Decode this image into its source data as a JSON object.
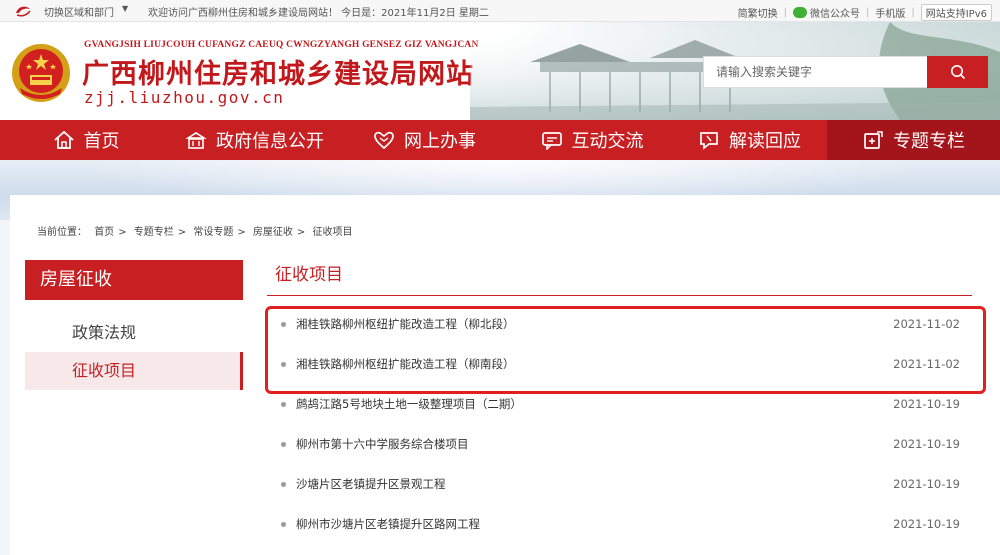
{
  "topbar": {
    "switch_label": "切换区域和部门",
    "welcome": "欢迎访问广西柳州住房和城乡建设局网站！ 今日是：2021年11月2日   星期二",
    "traditional": "简繁切换",
    "wechat": "微信公众号",
    "mobile": "手机版",
    "ipv6": "网站支持IPv6"
  },
  "header": {
    "pinyin": "GVANGJSIH LIUJCOUH CUFANGZ CAEUQ CWNGZYANGH GENSEZ GIZ VANGJCAN",
    "title": "广西柳州住房和城乡建设局网站",
    "domain": "zjj.liuzhou.gov.cn"
  },
  "search": {
    "placeholder": "请输入搜索关键字"
  },
  "nav": {
    "items": [
      {
        "label": "首页",
        "icon": "home-icon"
      },
      {
        "label": "政府信息公开",
        "icon": "building-icon"
      },
      {
        "label": "网上办事",
        "icon": "handshake-icon"
      },
      {
        "label": "互动交流",
        "icon": "chat-icon"
      },
      {
        "label": "解读回应",
        "icon": "comment-icon"
      },
      {
        "label": "专题专栏",
        "icon": "edit-icon",
        "active": true
      }
    ]
  },
  "breadcrumb": {
    "prefix": "当前位置：",
    "items": [
      "首页",
      "专题专栏",
      "常设专题",
      "房屋征收",
      "征收项目"
    ]
  },
  "sidebar": {
    "title": "房屋征收",
    "items": [
      {
        "label": "政策法规",
        "active": false
      },
      {
        "label": "征收项目",
        "active": true
      }
    ]
  },
  "content": {
    "title": "征收项目",
    "rows": [
      {
        "title": "湘桂铁路柳州枢纽扩能改造工程（柳北段）",
        "date": "2021-11-02"
      },
      {
        "title": "湘桂铁路柳州枢纽扩能改造工程（柳南段）",
        "date": "2021-11-02"
      },
      {
        "title": "鹧鸪江路5号地块土地一级整理项目（二期）",
        "date": "2021-10-19"
      },
      {
        "title": "柳州市第十六中学服务综合楼项目",
        "date": "2021-10-19"
      },
      {
        "title": "沙塘片区老镇提升区景观工程",
        "date": "2021-10-19"
      },
      {
        "title": "柳州市沙塘片区老镇提升区路网工程",
        "date": "2021-10-19"
      }
    ]
  },
  "colors": {
    "brand_red": "#c71f22",
    "nav_active": "#a3151a",
    "highlight_border": "#e32020"
  }
}
